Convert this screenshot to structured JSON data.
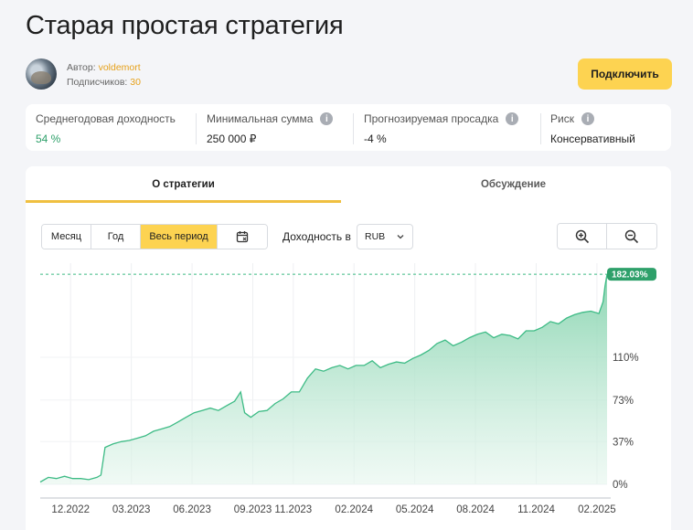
{
  "page": {
    "title": "Старая простая стратегия"
  },
  "author": {
    "author_label": "Автор:",
    "author_name": "voldemort",
    "subscribers_label": "Подписчиков:",
    "subscribers_count": "30"
  },
  "actions": {
    "connect_label": "Подключить"
  },
  "stats": [
    {
      "label": "Среднегодовая доходность",
      "value": "54 %",
      "info": false
    },
    {
      "label": "Минимальная сумма",
      "value": "250 000 ₽",
      "info": true
    },
    {
      "label": "Прогнозируемая просадка",
      "value": "-4 %",
      "info": true
    },
    {
      "label": "Риск",
      "value": "Консервативный",
      "info": true
    }
  ],
  "tabs": [
    {
      "label": "О стратегии",
      "active": true
    },
    {
      "label": "Обсуждение",
      "active": false
    }
  ],
  "period": {
    "options": [
      "Месяц",
      "Год",
      "Весь период"
    ],
    "selected": "Весь период"
  },
  "yield": {
    "label": "Доходность в",
    "currency": "RUB"
  },
  "icons": {
    "calendar": "calendar-icon",
    "zoom_in": "zoom-in-icon",
    "zoom_out": "zoom-out-icon",
    "chevron": "chevron-down-icon"
  },
  "colors": {
    "accent": "#fdd351",
    "positive": "#2ea06a",
    "chart_line": "#3dbb85",
    "chart_fill": "#8fd9b6"
  },
  "chart_data": {
    "type": "area",
    "y_tick_labels": [
      "0%",
      "37%",
      "73%",
      "110%"
    ],
    "y_ticks": [
      0,
      37,
      73,
      110
    ],
    "ylim": [
      0,
      190
    ],
    "x_tick_labels": [
      "12.2022",
      "03.2023",
      "06.2023",
      "09.2023",
      "11.2023",
      "02.2024",
      "05.2024",
      "08.2024",
      "11.2024",
      "02.2025"
    ],
    "x_tick_months": [
      1.5,
      4.5,
      7.5,
      10.5,
      12.5,
      15.5,
      18.5,
      21.5,
      24.5,
      27.5
    ],
    "xlim_months": [
      0,
      28
    ],
    "last_value_label": "182.03%",
    "last_value": 182.03,
    "series": [
      {
        "x": [
          0,
          0.4,
          0.8,
          1.2,
          1.6,
          2.0,
          2.4,
          2.8,
          3.0,
          3.2,
          3.6,
          4.0,
          4.4,
          4.8,
          5.2,
          5.6,
          6.0,
          6.4,
          6.8,
          7.2,
          7.6,
          8.0,
          8.4,
          8.8,
          9.2,
          9.6,
          9.9,
          10.1,
          10.4,
          10.8,
          11.2,
          11.6,
          12.0,
          12.4,
          12.8,
          13.2,
          13.6,
          14.0,
          14.4,
          14.8,
          15.2,
          15.6,
          16.0,
          16.4,
          16.8,
          17.2,
          17.6,
          18.0,
          18.4,
          18.8,
          19.2,
          19.6,
          20.0,
          20.4,
          20.8,
          21.2,
          21.6,
          22.0,
          22.4,
          22.8,
          23.2,
          23.6,
          24.0,
          24.4,
          24.8,
          25.2,
          25.6,
          26.0,
          26.4,
          26.8,
          27.2,
          27.6,
          27.8,
          27.9,
          28.0
        ],
        "y": [
          2,
          6,
          5,
          7,
          5,
          5,
          4,
          6,
          8,
          32,
          35,
          37,
          38,
          40,
          42,
          46,
          48,
          50,
          54,
          58,
          62,
          64,
          66,
          64,
          68,
          72,
          80,
          62,
          58,
          63,
          64,
          70,
          74,
          80,
          80,
          92,
          100,
          98,
          101,
          103,
          100,
          103,
          103,
          107,
          101,
          104,
          106,
          105,
          109,
          112,
          116,
          122,
          125,
          120,
          123,
          127,
          130,
          132,
          127,
          130,
          129,
          126,
          133,
          133,
          136,
          141,
          139,
          144,
          147,
          149,
          150,
          148,
          158,
          172,
          182.03
        ]
      }
    ]
  }
}
